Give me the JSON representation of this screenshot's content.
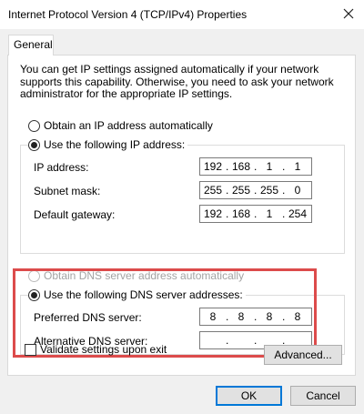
{
  "window": {
    "title": "Internet Protocol Version 4 (TCP/IPv4) Properties",
    "close_icon": "close-icon"
  },
  "tabs": [
    {
      "label": "General",
      "active": true
    }
  ],
  "description": "You can get IP settings assigned automatically if your network supports this capability. Otherwise, you need to ask your network administrator for the appropriate IP settings.",
  "ip_section": {
    "auto_label": "Obtain an IP address automatically",
    "manual_label": "Use the following IP address:",
    "selected": "manual",
    "fields": {
      "ip_address": {
        "label": "IP address:",
        "octets": [
          "192",
          "168",
          "1",
          "1"
        ]
      },
      "subnet_mask": {
        "label": "Subnet mask:",
        "octets": [
          "255",
          "255",
          "255",
          "0"
        ]
      },
      "default_gateway": {
        "label": "Default gateway:",
        "octets": [
          "192",
          "168",
          "1",
          "254"
        ]
      }
    }
  },
  "dns_section": {
    "auto_label": "Obtain DNS server address automatically",
    "auto_disabled": true,
    "manual_label": "Use the following DNS server addresses:",
    "selected": "manual",
    "fields": {
      "preferred": {
        "label": "Preferred DNS server:",
        "octets": [
          "8",
          "8",
          "8",
          "8"
        ]
      },
      "alternative": {
        "label": "Alternative DNS server:",
        "octets": [
          "",
          "",
          "",
          ""
        ]
      }
    }
  },
  "validate": {
    "label": "Validate settings upon exit",
    "checked": false
  },
  "buttons": {
    "advanced": "Advanced...",
    "ok": "OK",
    "cancel": "Cancel"
  },
  "colors": {
    "highlight_border": "#dc4b4b",
    "default_button_border": "#0078d7",
    "dialog_background": "#f0f0f0"
  }
}
